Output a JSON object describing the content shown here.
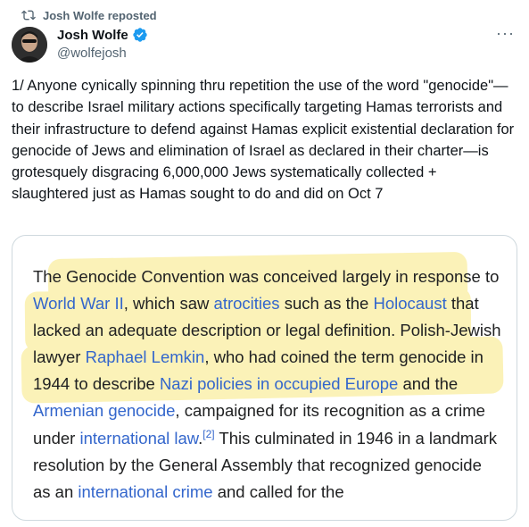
{
  "repost": {
    "label": "Josh Wolfe reposted",
    "icon": "repost-icon"
  },
  "author": {
    "name": "Josh Wolfe",
    "handle": "@wolfejosh",
    "verified": true,
    "verified_color": "#1d9bf0"
  },
  "more": {
    "icon": "more-icon",
    "label": "···"
  },
  "tweet": {
    "text": "1/ Anyone cynically spinning thru repetition the use of the word \"genocide\"—to describe Israel military actions specifically targeting Hamas terrorists and their infrastructure to defend against Hamas explicit existential declaration for genocide of Jews and elimination of Israel as declared in their charter—is grotesquely disgracing 6,000,000 Jews systematically collected + slaughtered just as Hamas sought to do and did on Oct 7"
  },
  "card": {
    "highlight_color": "#fbf2b8",
    "link_color": "#3366cc",
    "segments": [
      {
        "text": "The Genocide Convention was conceived largely in response to ",
        "link": false
      },
      {
        "text": "World War II",
        "link": true
      },
      {
        "text": ", which saw ",
        "link": false
      },
      {
        "text": "atrocities",
        "link": true
      },
      {
        "text": " such as the ",
        "link": false
      },
      {
        "text": "Holocaust",
        "link": true
      },
      {
        "text": " that lacked an adequate description or legal definition. Polish-Jewish lawyer ",
        "link": false
      },
      {
        "text": "Raphael Lemkin",
        "link": true
      },
      {
        "text": ", who had coined the term genocide in 1944 to describe ",
        "link": false
      },
      {
        "text": "Nazi policies in occupied Europe",
        "link": true
      },
      {
        "text": " and the ",
        "link": false
      },
      {
        "text": "Armenian genocide",
        "link": true
      },
      {
        "text": ", campaigned for its recognition as a crime under ",
        "link": false
      },
      {
        "text": "international law",
        "link": true
      },
      {
        "text": ".",
        "link": false
      },
      {
        "text": "[2]",
        "link": true,
        "sup": true
      },
      {
        "text": " This culminated in 1946 in a landmark resolution by the General Assembly that recognized genocide as an ",
        "link": false
      },
      {
        "text": "international crime",
        "link": true
      },
      {
        "text": " and called for the",
        "link": false
      }
    ]
  }
}
